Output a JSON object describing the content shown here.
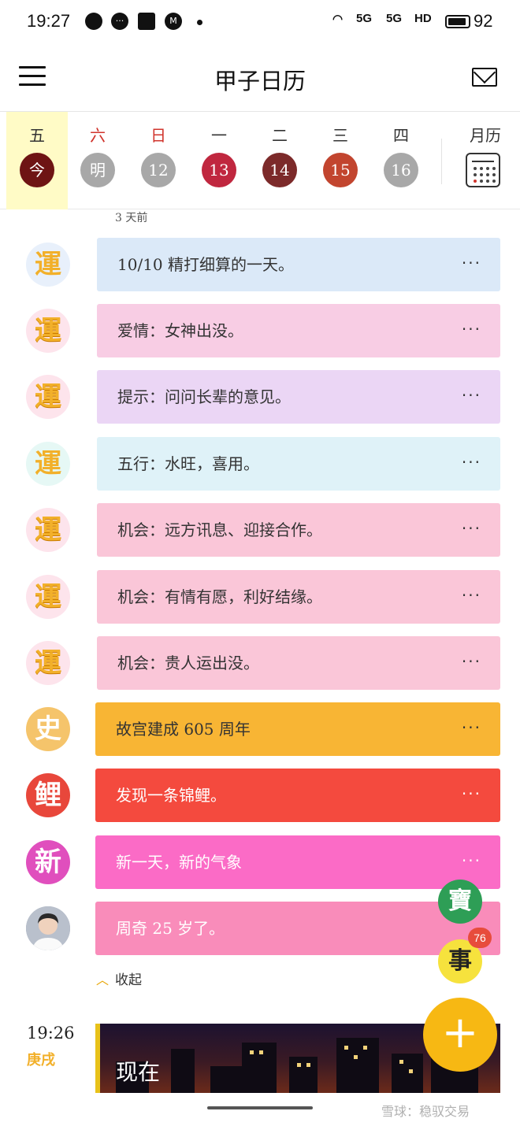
{
  "status_bar": {
    "time": "19:27",
    "network_label": "5G",
    "hd_label": "HD",
    "battery": "92"
  },
  "header": {
    "title": "甲子日历",
    "menu_icon": "hamburger-menu-icon",
    "mail_icon": "mail-icon"
  },
  "week": {
    "days": [
      {
        "weekday": "五",
        "date": "今",
        "weekday_color": "#333333",
        "circle_color": "#6e1414",
        "today": true
      },
      {
        "weekday": "六",
        "date": "明",
        "weekday_color": "#d0342c",
        "circle_color": "#a8a8a8",
        "today": false
      },
      {
        "weekday": "日",
        "date": "12",
        "weekday_color": "#d0342c",
        "circle_color": "#a8a8a8",
        "today": false
      },
      {
        "weekday": "一",
        "date": "13",
        "weekday_color": "#333333",
        "circle_color": "#c0273f",
        "today": false
      },
      {
        "weekday": "二",
        "date": "14",
        "weekday_color": "#333333",
        "circle_color": "#7c2a2a",
        "today": false
      },
      {
        "weekday": "三",
        "date": "15",
        "weekday_color": "#333333",
        "circle_color": "#c2452f",
        "today": false
      },
      {
        "weekday": "四",
        "date": "16",
        "weekday_color": "#333333",
        "circle_color": "#a8a8a8",
        "today": false
      }
    ],
    "calendar_label": "月历",
    "calendar_icon": "calendar-grid-icon"
  },
  "timeline": {
    "ago_label": "3 天前",
    "events": [
      {
        "avatar": "運",
        "avatar_style": "yun-blue",
        "text": "10/10  精打细算的一天。",
        "bg": "#dbe9f8",
        "solid": false
      },
      {
        "avatar": "運",
        "avatar_style": "yun",
        "text": "爱情：女神出没。",
        "bg": "#f8cde4",
        "solid": false
      },
      {
        "avatar": "運",
        "avatar_style": "yun",
        "text": "提示：问问长辈的意见。",
        "bg": "#ebd6f5",
        "solid": false
      },
      {
        "avatar": "運",
        "avatar_style": "yun-cyan",
        "text": "五行：水旺，喜用。",
        "bg": "#dff2f8",
        "solid": false
      },
      {
        "avatar": "運",
        "avatar_style": "yun",
        "text": "机会：远方讯息、迎接合作。",
        "bg": "#fac6d8",
        "solid": false
      },
      {
        "avatar": "運",
        "avatar_style": "yun",
        "text": "机会：有情有愿，利好结缘。",
        "bg": "#fac6d8",
        "solid": false
      },
      {
        "avatar": "運",
        "avatar_style": "yun",
        "text": "机会：贵人运出没。",
        "bg": "#fac6d8",
        "solid": false
      },
      {
        "avatar": "史",
        "avatar_style": "shi",
        "text": "故宫建成 605 周年",
        "bg": "#f8b534",
        "solid": false
      },
      {
        "avatar": "鲤",
        "avatar_style": "li",
        "text": "发现一条锦鲤。",
        "bg": "#f44a3e",
        "solid": true
      },
      {
        "avatar": "新",
        "avatar_style": "xin",
        "text": "新一天，新的气象",
        "bg": "#fb6bc6",
        "solid": true
      },
      {
        "avatar": "",
        "avatar_style": "person",
        "text": "周奇 25 岁了。",
        "bg": "#f98cba",
        "solid": true
      }
    ],
    "more_label": "···",
    "collapse_label": "收起"
  },
  "now": {
    "time": "19:26",
    "ganzhi": "庚戌",
    "label": "现在"
  },
  "floating": {
    "bao_label": "寶",
    "shi_label": "事",
    "badge_count": "76",
    "add_icon": "plus-icon",
    "add_label": "+"
  },
  "watermark": "雪球：稳驭交易",
  "colors": {
    "accent": "#f7b813",
    "today_highlight": "#fffbc6"
  }
}
